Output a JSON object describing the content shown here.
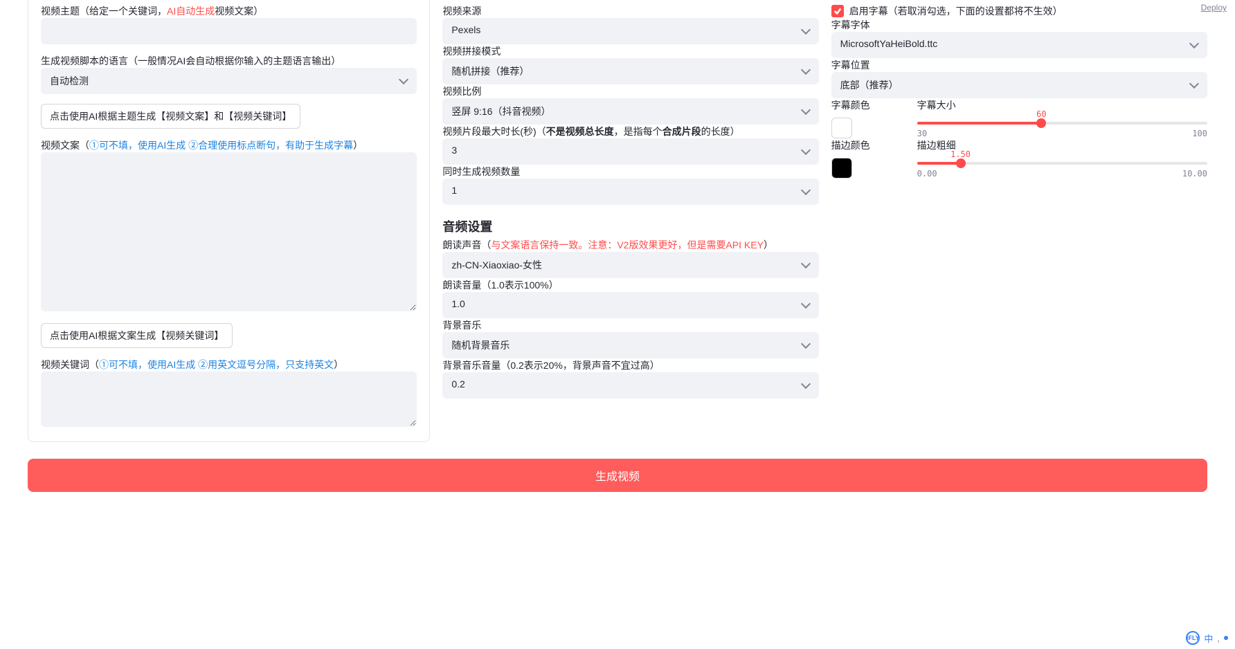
{
  "deploy": "Deploy",
  "left": {
    "videoTopicLabelPre": "视频主题（给定一个关键词，",
    "videoTopicLabelRed": "AI自动生成",
    "videoTopicLabelPost": "视频文案）",
    "scriptLangLabel": "生成视频脚本的语言（一般情况AI会自动根据你输入的主题语言输出）",
    "scriptLangValue": "自动检测",
    "genByTopicBtn": "点击使用AI根据主题生成【视频文案】和【视频关键词】",
    "videoScriptLabelPre": "视频文案（",
    "videoScriptLabelBlue": "①可不填，使用AI生成 ②合理使用标点断句，有助于生成字幕",
    "videoScriptLabelPost": "）",
    "genByScriptBtn": "点击使用AI根据文案生成【视频关键词】",
    "videoKeywordsLabelPre": "视频关键词（",
    "videoKeywordsLabelBlue": "①可不填，使用AI生成 ②用英文逗号分隔，只支持英文",
    "videoKeywordsLabelPost": "）"
  },
  "mid1": {
    "videoSourceLabel": "视频来源",
    "videoSourceValue": "Pexels",
    "concatModeLabel": "视频拼接模式",
    "concatModeValue": "随机拼接（推荐）",
    "aspectLabel": "视频比例",
    "aspectValue": "竖屏 9:16（抖音视频）",
    "clipMaxLabelPre": "视频片段最大时长(秒)（",
    "clipMaxLabelBold1": "不是视频总长度",
    "clipMaxLabelMid": "，是指每个",
    "clipMaxLabelBold2": "合成片段",
    "clipMaxLabelPost": "的长度）",
    "clipMaxValue": "3",
    "concurrentLabel": "同时生成视频数量",
    "concurrentValue": "1"
  },
  "mid2": {
    "title": "音频设置",
    "voiceLabelPre": "朗读声音（",
    "voiceLabelRed": "与文案语言保持一致。注意：V2版效果更好，但是需要API KEY",
    "voiceLabelPost": "）",
    "voiceValue": "zh-CN-Xiaoxiao-女性",
    "voiceVolumeLabel": "朗读音量（1.0表示100%）",
    "voiceVolumeValue": "1.0",
    "bgmLabel": "背景音乐",
    "bgmValue": "随机背景音乐",
    "bgmVolumeLabel": "背景音乐音量（0.2表示20%，背景声音不宜过高）",
    "bgmVolumeValue": "0.2"
  },
  "right": {
    "enableSubtitle": "启用字幕（若取消勾选，下面的设置都将不生效）",
    "fontLabel": "字幕字体",
    "fontValue": "MicrosoftYaHeiBold.ttc",
    "posLabel": "字幕位置",
    "posValue": "底部（推荐）",
    "colorLabel": "字幕颜色",
    "sizeLabel": "字幕大小",
    "sizeValue": "60",
    "sizeMin": "30",
    "sizeMax": "100",
    "strokeColorLabel": "描边颜色",
    "strokeWidthLabel": "描边粗细",
    "strokeWidthValue": "1.50",
    "strokeMin": "0.00",
    "strokeMax": "10.00"
  },
  "generate": "生成视频",
  "ime": {
    "logo": "iFLY",
    "cn": "中"
  }
}
